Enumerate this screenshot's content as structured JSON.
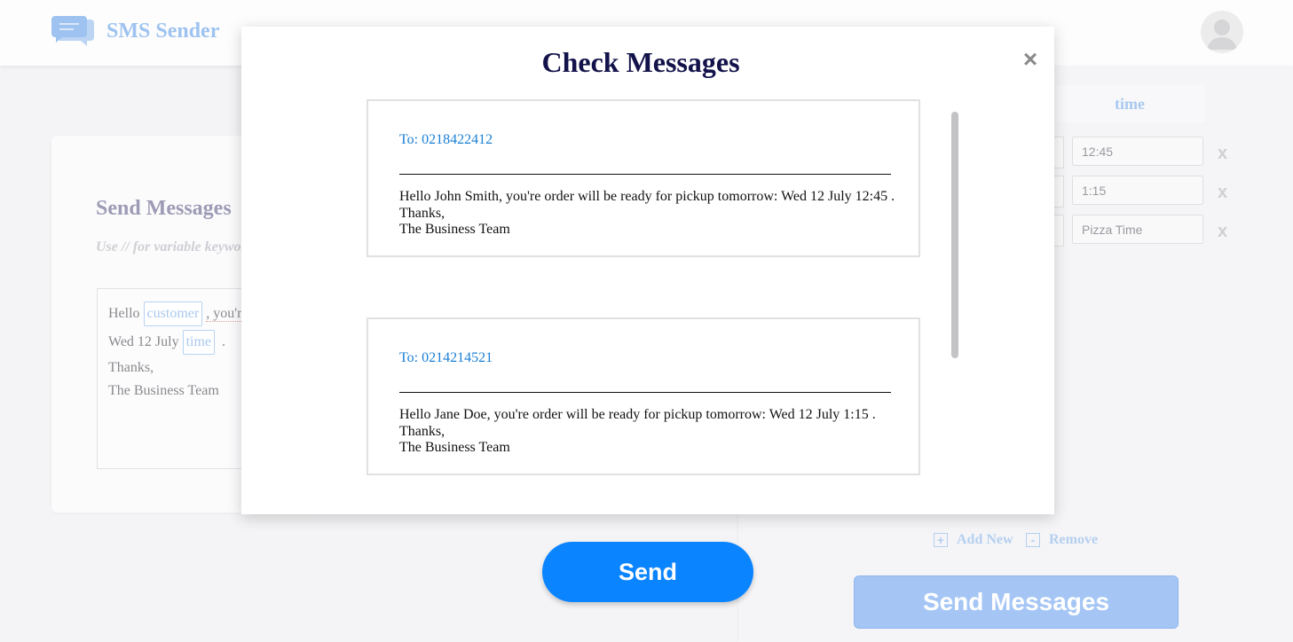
{
  "header": {
    "app_title": "SMS Sender",
    "logo_icon": "chat-bubbles-icon",
    "avatar_icon": "user-avatar-icon"
  },
  "send_messages_card": {
    "title": "Send Messages",
    "hint": "Use // for variable keywo",
    "template": {
      "line1_prefix": "Hello",
      "line1_chip": "customer",
      "line1_suffix": ", you'r",
      "line2_prefix": "Wed 12 July",
      "line2_chip": "time",
      "line2_suffix": ".",
      "line3": "Thanks,",
      "line4": "The Business Team"
    }
  },
  "variables_table": {
    "column_header": "time",
    "rows": [
      {
        "time": "12:45"
      },
      {
        "time": "1:15"
      },
      {
        "time": "Pizza Time"
      }
    ],
    "remove_row_label": "x",
    "add_new_label": "Add New",
    "add_new_icon": "+",
    "remove_label": "Remove",
    "remove_icon": "-",
    "send_messages_label": "Send Messages"
  },
  "modal": {
    "title": "Check Messages",
    "close_label": "×",
    "messages": [
      {
        "to": "To: 0218422412",
        "line1": "Hello John Smith, you're order will be ready for pickup tomorrow: Wed 12 July 12:45 .",
        "line2": "Thanks,",
        "line3": "The Business Team"
      },
      {
        "to": "To: 0214214521",
        "line1": "Hello Jane Doe, you're order will be ready for pickup tomorrow: Wed 12 July 1:15 .",
        "line2": "Thanks,",
        "line3": "The Business Team"
      }
    ],
    "send_label": "Send"
  },
  "colors": {
    "accent": "#0a84ff",
    "title_navy": "#13124a",
    "link_blue": "#1a7fd6",
    "muted_blue": "#a5c6f5"
  }
}
